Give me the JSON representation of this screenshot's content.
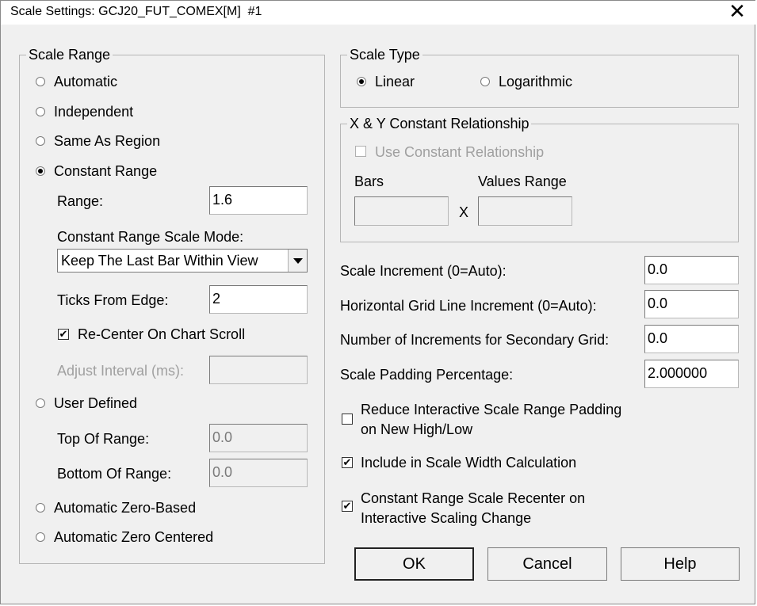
{
  "window": {
    "title": "Scale Settings: GCJ20_FUT_COMEX[M]  #1",
    "close_glyph": "✕"
  },
  "scale_range": {
    "legend": "Scale Range",
    "options": {
      "automatic": "Automatic",
      "independent": "Independent",
      "same_as_region": "Same As Region",
      "constant_range": "Constant Range",
      "user_defined": "User Defined",
      "automatic_zero_based": "Automatic Zero-Based",
      "automatic_zero_centered": "Automatic Zero Centered"
    },
    "selected": "constant_range",
    "range_label": "Range:",
    "range_value": "1.6",
    "mode_label": "Constant Range Scale Mode:",
    "mode_value": "Keep The Last Bar Within View",
    "ticks_label": "Ticks From Edge:",
    "ticks_value": "2",
    "recenter_label": "Re-Center On Chart Scroll",
    "recenter_checked": true,
    "adjust_label": "Adjust Interval (ms):",
    "adjust_value": "",
    "top_label": "Top Of Range:",
    "top_value": "0.0",
    "bottom_label": "Bottom Of Range:",
    "bottom_value": "0.0"
  },
  "scale_type": {
    "legend": "Scale Type",
    "linear": "Linear",
    "logarithmic": "Logarithmic",
    "selected": "linear"
  },
  "xy": {
    "legend": "X & Y Constant Relationship",
    "use_label": "Use Constant Relationship",
    "use_checked": false,
    "bars_label": "Bars",
    "values_label": "Values Range",
    "x_glyph": "X",
    "bars_value": "",
    "values_value": ""
  },
  "fields": {
    "scale_increment_label": "Scale Increment (0=Auto):",
    "scale_increment_value": "0.0",
    "hgrid_label": "Horizontal Grid Line Increment (0=Auto):",
    "hgrid_value": "0.0",
    "secondary_label": "Number of Increments for Secondary Grid:",
    "secondary_value": "0.0",
    "padding_label": "Scale Padding Percentage:",
    "padding_value": "2.000000"
  },
  "checks": {
    "reduce_line1": "Reduce Interactive Scale Range Padding",
    "reduce_line2": "on New High/Low",
    "reduce_checked": false,
    "include_label": "Include in Scale Width Calculation",
    "include_checked": true,
    "recenter_line1": "Constant Range Scale Recenter on",
    "recenter_line2": "Interactive Scaling Change",
    "recenter_checked": true
  },
  "buttons": {
    "ok": "OK",
    "cancel": "Cancel",
    "help": "Help"
  },
  "check_glyph": "✔"
}
